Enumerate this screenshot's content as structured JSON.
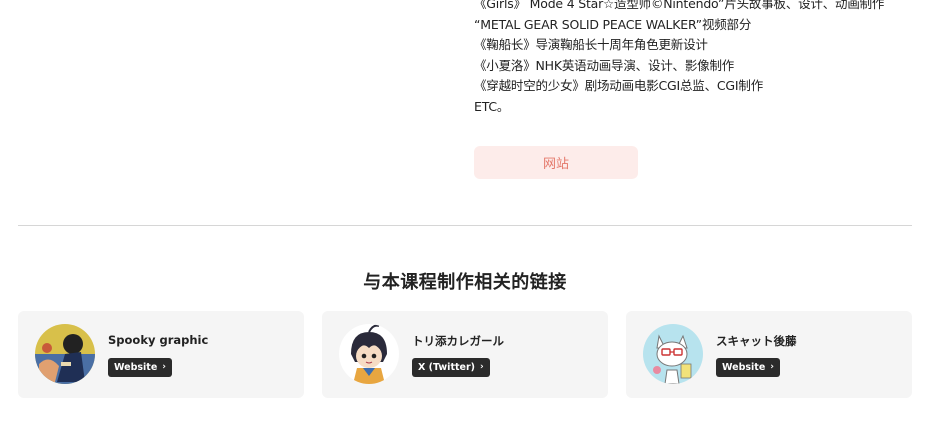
{
  "bio": {
    "lines": [
      "《Girls》 Mode 4 Star☆造型师©Nintendo”片头故事板、设计、动画制作",
      "“METAL GEAR SOLID PEACE WALKER”视频部分",
      "《鞠船长》导演鞠船长十周年角色更新设计",
      "《小夏洛》NHK英语动画导演、设计、影像制作",
      "《穿越时空的少女》剧场动画电影CGI总监、CGI制作",
      "ETC。"
    ]
  },
  "website_button": {
    "label": "网站"
  },
  "related": {
    "title": "与本课程制作相关的链接",
    "cards": [
      {
        "name": "Spooky graphic",
        "link_label": "Website",
        "avatar_icon": "spooky-graphic-avatar"
      },
      {
        "name": "トリ添カレガール",
        "link_label": "X (Twitter)",
        "avatar_icon": "anime-girl-avatar"
      },
      {
        "name": "スキャット後藤",
        "link_label": "Website",
        "avatar_icon": "cat-character-avatar"
      }
    ],
    "chevron": "›"
  },
  "colors": {
    "accent_button_bg": "#fdecea",
    "accent_button_text": "#e4786a",
    "card_bg": "#f5f5f5",
    "link_pill_bg": "#2b2b2b"
  }
}
